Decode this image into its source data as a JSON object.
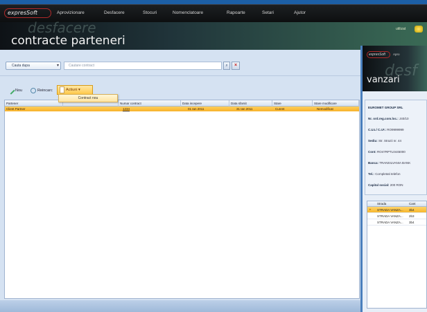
{
  "app": {
    "logo_text": "expresSoft",
    "logo_tagline": "software solutions",
    "menu": [
      "Aprovizionare",
      "Desfacere",
      "Stocuri",
      "Nomenclatoare",
      "Rapoarte",
      "Setari",
      "Ajutor"
    ],
    "module_watermark": "desfacere",
    "page_title": "contracte parteneri",
    "user_label": "utilizat"
  },
  "filter": {
    "selected": "Cauta dupa",
    "placeholder": "Cautare contract"
  },
  "toolbar": {
    "add_label": "Nou",
    "refresh_label": "Reincarc",
    "actions_label": "Actiuni",
    "dropdown_item": "Contract nou"
  },
  "grid": {
    "columns": [
      "Partener",
      "",
      "Numar contract",
      "Data incepere",
      "Data sfarsit",
      "Stare",
      "Stare modificare"
    ],
    "rows": [
      [
        "Client Partner",
        "",
        "1234",
        "01 Ian 2011",
        "31 Ian 2011",
        "Curent",
        "Nemodificat"
      ]
    ]
  },
  "right_window": {
    "logo_text": "expresSoft",
    "menu_first": "Apro",
    "module_watermark": "desf",
    "page_title": "vanzari",
    "company": {
      "name": "EUROMET GROUP SRL",
      "nr_reg_label": "Nr. ord.reg.com.loc.:",
      "nr_reg_value": "J40/10",
      "cui_label": "C.U.I./ C.I.F.:",
      "cui_value": "RO9999999",
      "sediu_label": "Sediu:",
      "sediu_value": "Str. Strazii nr. 44",
      "cont_label": "Cont:",
      "cont_value": "RO47RPTL0445000",
      "banca_label": "Banca:",
      "banca_value": "TRANSILVANIA BANK",
      "tel_label": "Tel.:",
      "tel_value": "Completati telefon",
      "capital_label": "Capital social:",
      "capital_value": "200 RON"
    },
    "grid_header": [
      "Strada",
      "Cant"
    ],
    "grid_rows": [
      {
        "c1": "STRADA VANZA...",
        "c2": "3b4",
        "selected": true
      },
      {
        "c1": "STRADA VANZA...",
        "c2": "2b3",
        "selected": false
      },
      {
        "c1": "STRADA VANZA...",
        "c2": "3b4",
        "selected": false
      }
    ]
  },
  "colors": {
    "selection": "#ffc94a",
    "header_dark": "#0e1216",
    "accent_blue": "#1c5fa6"
  }
}
